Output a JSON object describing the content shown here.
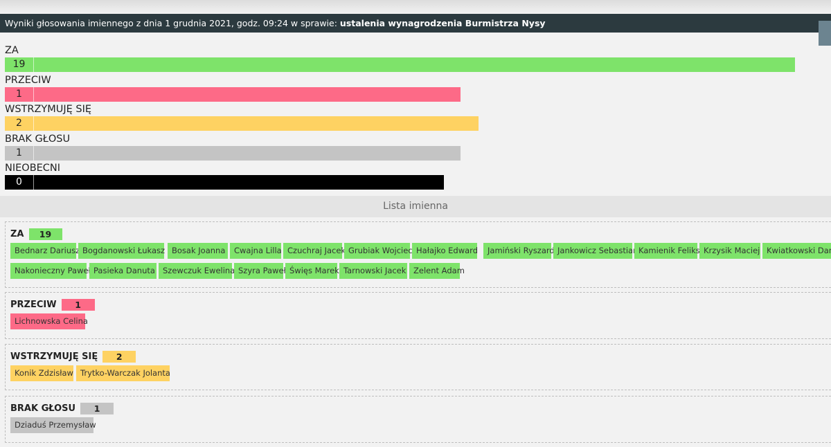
{
  "header": {
    "prefix": "Wyniki głosowania imiennego z dnia 1 grudnia 2021, godz. 09:24 w sprawie:",
    "subject": "ustalenia wynagrodzenia Burmistrza Nysy"
  },
  "colors": {
    "za": "#7ee36a",
    "przeciw": "#fd6a87",
    "wstrzymuje": "#fed262",
    "brak": "#c4c4c4",
    "nieobecni": "#000000"
  },
  "summary": [
    {
      "label": "ZA",
      "count": "19",
      "fill": 0.967,
      "color": "#7ee36a",
      "text": "#222"
    },
    {
      "label": "PRZECIW",
      "count": "1",
      "fill": 0.558,
      "color": "#fd6a87",
      "text": "#222"
    },
    {
      "label": "WSTRZYMUJĘ SIĘ",
      "count": "2",
      "fill": 0.58,
      "color": "#fed262",
      "text": "#222"
    },
    {
      "label": "BRAK GŁOSU",
      "count": "1",
      "fill": 0.558,
      "color": "#c4c4c4",
      "text": "#222"
    },
    {
      "label": "NIEOBECNI",
      "count": "0",
      "fill": 0.537,
      "color": "#000000",
      "text": "#fff"
    }
  ],
  "list_title": "Lista imienna",
  "groups": [
    {
      "label": "ZA",
      "count": "19",
      "color": "#7ee36a",
      "names": [
        "Bednarz Dariusz",
        "Bogdanowski Łukasz",
        "Bosak Joanna",
        "Cwajna Lilla",
        "Czuchraj Jacek",
        "Grubiak Wojciech",
        "Hałajko Edward",
        "Jamiński Ryszard",
        "Jankowicz Sebastian",
        "Kamienik Feliks",
        "Krzysik Maciej",
        "Kwiatkowski Damian",
        "Nakonieczny Paweł",
        "Pasieka Danuta",
        "Szewczuk Ewelina",
        "Szyra Paweł",
        "Święs Marek",
        "Tarnowski Jacek",
        "Zelent Adam"
      ]
    },
    {
      "label": "PRZECIW",
      "count": "1",
      "color": "#fd6a87",
      "names": [
        "Lichnowska Celina"
      ]
    },
    {
      "label": "WSTRZYMUJĘ SIĘ",
      "count": "2",
      "color": "#fed262",
      "names": [
        "Konik Zdzisław",
        "Trytko-Warczak Jolanta"
      ]
    },
    {
      "label": "BRAK GŁOSU",
      "count": "1",
      "color": "#c4c4c4",
      "names": [
        "Dziaduś Przemysław"
      ]
    }
  ]
}
